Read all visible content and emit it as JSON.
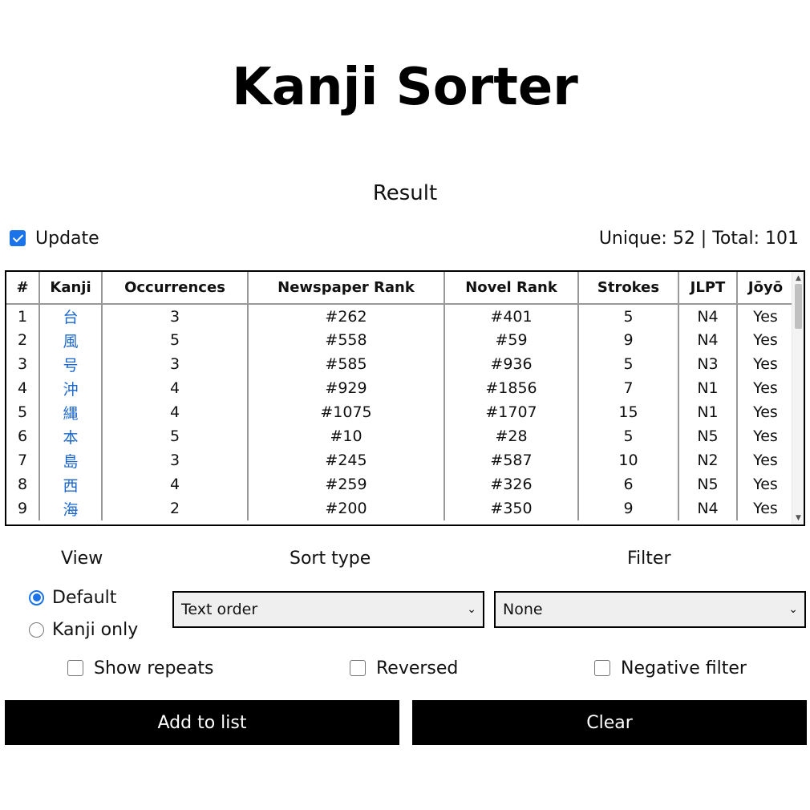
{
  "page": {
    "title": "Kanji Sorter",
    "result_heading": "Result"
  },
  "update": {
    "label": "Update",
    "checked": true
  },
  "stats": {
    "text": "Unique: 52 | Total: 101"
  },
  "table": {
    "headers": [
      "#",
      "Kanji",
      "Occurrences",
      "Newspaper Rank",
      "Novel Rank",
      "Strokes",
      "JLPT",
      "Jōyō"
    ],
    "rows": [
      [
        "1",
        "台",
        "3",
        "#262",
        "#401",
        "5",
        "N4",
        "Yes"
      ],
      [
        "2",
        "風",
        "5",
        "#558",
        "#59",
        "9",
        "N4",
        "Yes"
      ],
      [
        "3",
        "号",
        "3",
        "#585",
        "#936",
        "5",
        "N3",
        "Yes"
      ],
      [
        "4",
        "沖",
        "4",
        "#929",
        "#1856",
        "7",
        "N1",
        "Yes"
      ],
      [
        "5",
        "縄",
        "4",
        "#1075",
        "#1707",
        "15",
        "N1",
        "Yes"
      ],
      [
        "6",
        "本",
        "5",
        "#10",
        "#28",
        "5",
        "N5",
        "Yes"
      ],
      [
        "7",
        "島",
        "3",
        "#245",
        "#587",
        "10",
        "N2",
        "Yes"
      ],
      [
        "8",
        "西",
        "4",
        "#259",
        "#326",
        "6",
        "N5",
        "Yes"
      ],
      [
        "9",
        "海",
        "2",
        "#200",
        "#350",
        "9",
        "N4",
        "Yes"
      ]
    ]
  },
  "view": {
    "label": "View",
    "options": [
      "Default",
      "Kanji only"
    ],
    "selected": "Default"
  },
  "sort": {
    "label": "Sort type",
    "selected": "Text order"
  },
  "filter": {
    "label": "Filter",
    "selected": "None"
  },
  "options": {
    "show_repeats": "Show repeats",
    "reversed": "Reversed",
    "negative_filter": "Negative filter"
  },
  "buttons": {
    "add": "Add to list",
    "clear": "Clear"
  },
  "colors": {
    "accent": "#1a73e8",
    "kanji_link": "#1a66cc",
    "button_bg": "#000000"
  }
}
